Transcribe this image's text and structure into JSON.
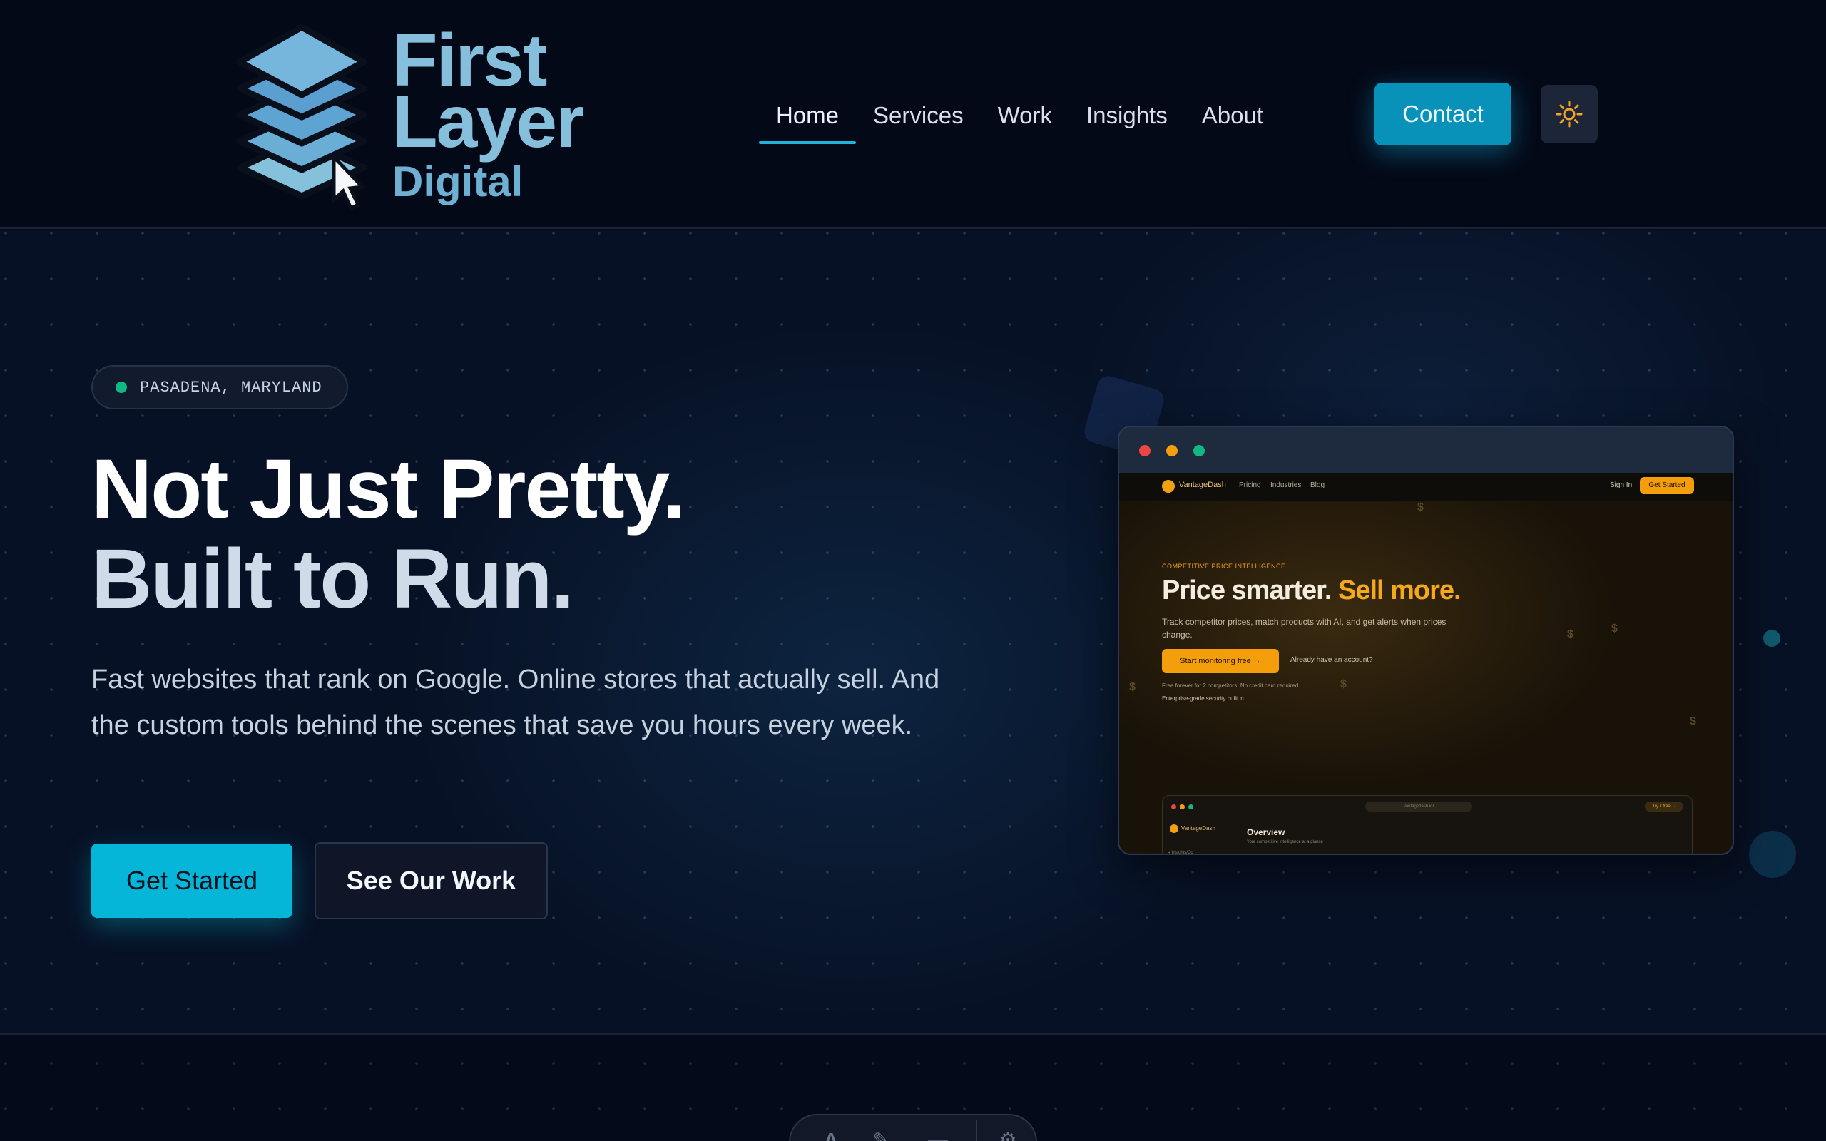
{
  "brand": {
    "line1": "First",
    "line2": "Layer",
    "line3": "Digital"
  },
  "nav": {
    "items": [
      {
        "label": "Home",
        "active": true
      },
      {
        "label": "Services"
      },
      {
        "label": "Work"
      },
      {
        "label": "Insights"
      },
      {
        "label": "About"
      }
    ],
    "contact_label": "Contact",
    "theme_icon": "sun-icon"
  },
  "hero": {
    "location": "PASADENA, MARYLAND",
    "headline_line1": "Not Just Pretty.",
    "headline_line2": "Built to Run.",
    "subtitle": "Fast websites that rank on Google. Online stores that actually sell. And the custom tools behind the scenes that save you hours every week.",
    "primary_cta": "Get Started",
    "secondary_cta": "See Our Work"
  },
  "mockup": {
    "brand": "VantageDash",
    "links": [
      "Pricing",
      "Industries",
      "Blog"
    ],
    "sign_in": "Sign In",
    "get_started": "Get Started",
    "eyebrow": "COMPETITIVE PRICE INTELLIGENCE",
    "headline_a": "Price smarter.",
    "headline_b": "Sell more.",
    "desc": "Track competitor prices, match products with AI, and get alerts when prices change.",
    "cta": "Start monitoring free →",
    "alt_link": "Already have an account?",
    "fine": "Free forever for 2 competitors. No credit card required.",
    "security": "Enterprise-grade security built in",
    "inner_url": "vantagedash.io/",
    "inner_try": "Try it free →",
    "inner_brand": "VantageDash",
    "inner_title": "Overview",
    "inner_desc": "Your competitive intelligence at a glance",
    "inner_back": "◂ Insights/Co"
  },
  "colors": {
    "accent": "#06b6d8",
    "background": "#071125",
    "mock_accent": "#f59e0b"
  }
}
